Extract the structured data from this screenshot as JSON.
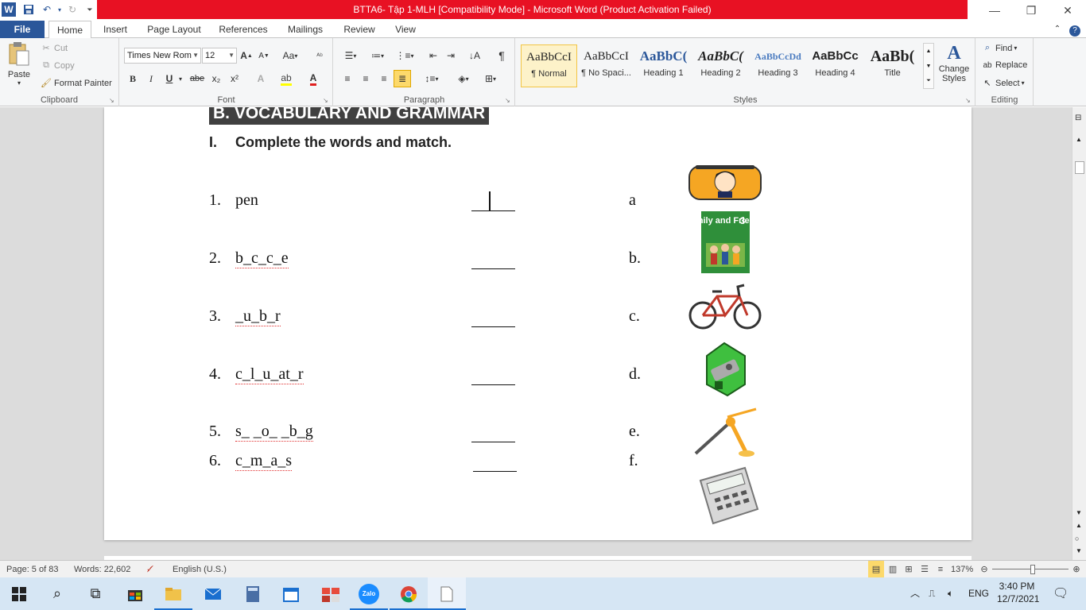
{
  "window": {
    "title": "BTTA6- Tập 1-MLH [Compatibility Mode] - Microsoft Word (Product Activation Failed)",
    "title_bar_color": "#e81123"
  },
  "quick_access": {
    "app_icon": "W",
    "icons": [
      "word-icon",
      "save-icon",
      "undo-icon",
      "redo-icon",
      "customize-icon"
    ]
  },
  "tabs": [
    "File",
    "Home",
    "Insert",
    "Page Layout",
    "References",
    "Mailings",
    "Review",
    "View"
  ],
  "ribbon": {
    "clipboard": {
      "label": "Clipboard",
      "paste": "Paste",
      "cut": "Cut",
      "copy": "Copy",
      "format_painter": "Format Painter"
    },
    "font": {
      "label": "Font",
      "font_name": "Times New Rom",
      "font_size": "12",
      "bold": "B",
      "italic": "I",
      "underline": "U",
      "strike": "abe",
      "subscript": "x₂",
      "superscript": "x²",
      "grow": "A",
      "shrink": "A",
      "change_case": "Aa",
      "font_color": "A"
    },
    "paragraph": {
      "label": "Paragraph"
    },
    "styles": {
      "label": "Styles",
      "items": [
        {
          "sample": "AaBbCcI",
          "name": "¶ Normal"
        },
        {
          "sample": "AaBbCcI",
          "name": "¶ No Spaci..."
        },
        {
          "sample": "AaBbC(",
          "name": "Heading 1"
        },
        {
          "sample": "AaBbC(",
          "name": "Heading 2"
        },
        {
          "sample": "AaBbCcDd",
          "name": "Heading 3"
        },
        {
          "sample": "AaBbCc",
          "name": "Heading 4"
        },
        {
          "sample": "AaBb(",
          "name": "Title"
        }
      ],
      "change_styles": "Change Styles"
    },
    "editing": {
      "label": "Editing",
      "find": "Find",
      "replace": "Replace",
      "select": "Select"
    }
  },
  "document": {
    "section_heading": "B. VOCABULARY AND GRAMMAR",
    "exercise_num": "I.",
    "exercise_title": "Complete the words and match.",
    "items": [
      {
        "num": "1.",
        "word": "pen",
        "blank": "__|__",
        "letter": "a",
        "picture": "pencil-case-icon"
      },
      {
        "num": "2.",
        "word": "b_c_c_e",
        "blank": "_____",
        "letter": "b.",
        "picture": "book-icon"
      },
      {
        "num": "3.",
        "word": "_u_b_r",
        "blank": "_____",
        "letter": "c.",
        "picture": "bicycle-icon"
      },
      {
        "num": "4.",
        "word": "c_l_u_at_r",
        "blank": "_____",
        "letter": "d.",
        "picture": "sharpener-icon"
      },
      {
        "num": "5.",
        "word": "s_ _o_ _b_g",
        "blank": "_____",
        "letter": "e.",
        "picture": "compass-icon"
      },
      {
        "num": "6.",
        "word": "c_m_a_s",
        "blank": "_____",
        "letter": "f.",
        "picture": "calculator-icon"
      }
    ],
    "book_title": "Family and Friends",
    "book_number": "3"
  },
  "status_bar": {
    "page": "Page: 5 of 83",
    "words": "Words: 22,602",
    "language": "English (U.S.)",
    "zoom": "137%"
  },
  "taskbar": {
    "time": "3:40 PM",
    "date": "12/7/2021",
    "lang": "ENG",
    "zalo": "Zalo"
  }
}
